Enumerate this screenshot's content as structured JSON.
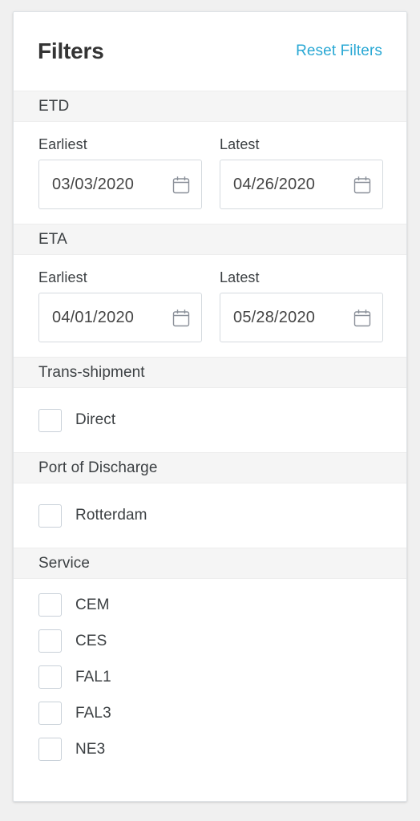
{
  "header": {
    "title": "Filters",
    "reset_label": "Reset Filters"
  },
  "sections": {
    "etd": {
      "band_label": "ETD",
      "earliest": {
        "label": "Earliest",
        "value": "03/03/2020"
      },
      "latest": {
        "label": "Latest",
        "value": "04/26/2020"
      }
    },
    "eta": {
      "band_label": "ETA",
      "earliest": {
        "label": "Earliest",
        "value": "04/01/2020"
      },
      "latest": {
        "label": "Latest",
        "value": "05/28/2020"
      }
    },
    "transshipment": {
      "band_label": "Trans-shipment",
      "options": [
        {
          "label": "Direct",
          "checked": false
        }
      ]
    },
    "port_of_discharge": {
      "band_label": "Port of Discharge",
      "options": [
        {
          "label": "Rotterdam",
          "checked": false
        }
      ]
    },
    "service": {
      "band_label": "Service",
      "options": [
        {
          "label": "CEM",
          "checked": false
        },
        {
          "label": "CES",
          "checked": false
        },
        {
          "label": "FAL1",
          "checked": false
        },
        {
          "label": "FAL3",
          "checked": false
        },
        {
          "label": "NE3",
          "checked": false
        }
      ]
    }
  },
  "icons": {
    "calendar": "calendar-icon",
    "checkbox": "checkbox-unchecked-icon"
  },
  "colors": {
    "accent_link": "#29a8d4",
    "band_background": "#f5f5f5",
    "text_primary": "#3c4043",
    "border": "#d5dadf",
    "page_background": "#f0f0f0"
  }
}
